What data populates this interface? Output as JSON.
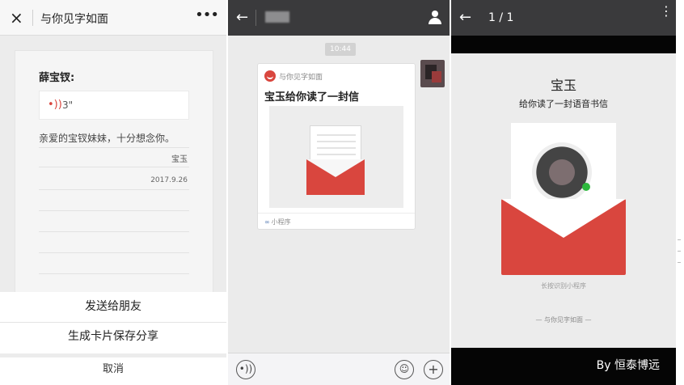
{
  "panel1": {
    "title": "与你见字如面",
    "close_icon": "×",
    "more_icon": "•••",
    "recipient": "薛宝钗:",
    "voice_icon": "•))",
    "voice_duration": "3\"",
    "message": "亲爱的宝钗妹妹，十分想念你。",
    "signature": "宝玉",
    "date": "2017.9.26",
    "sheet": {
      "send_to_friend": "发送给朋友",
      "save_card": "生成卡片保存分享",
      "cancel": "取消"
    }
  },
  "panel2": {
    "back_icon": "←",
    "time": "10:44",
    "card": {
      "source": "与你见字如面",
      "headline": "宝玉给你读了一封信",
      "mini_program_label": "小程序",
      "mini_icon": "∞"
    },
    "voice_toggle_icon": "•))",
    "emoji_icon": "☺",
    "plus_icon": "+"
  },
  "panel3": {
    "back_icon": "←",
    "counter": "1 / 1",
    "more_icon": "⋮",
    "name": "宝玉",
    "subtitle": "给你读了一封语音书信",
    "longpress": "长按识别小程序",
    "brand": "— 与你见字如面 —",
    "credit": "By 恒泰博远"
  }
}
